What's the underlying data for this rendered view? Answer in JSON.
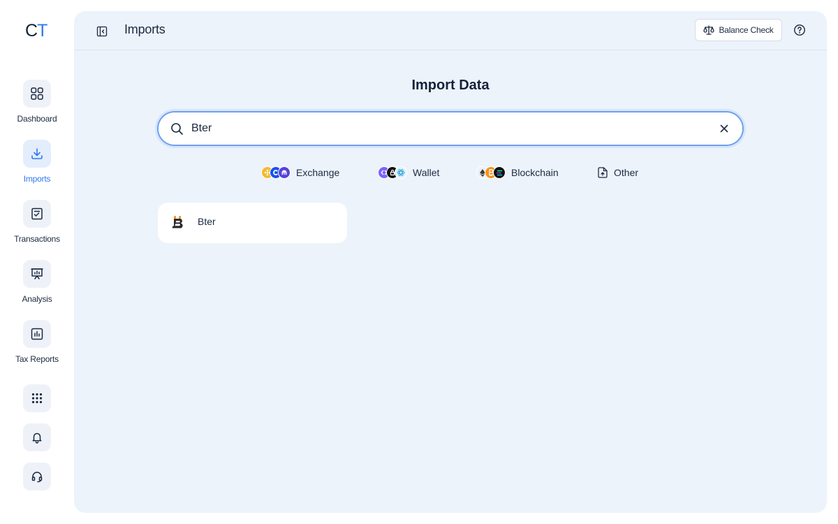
{
  "logo": {
    "c": "C",
    "t": "T"
  },
  "sidebar": {
    "items": [
      {
        "label": "Dashboard",
        "icon": "dashboard-icon"
      },
      {
        "label": "Imports",
        "icon": "download-icon",
        "active": true
      },
      {
        "label": "Transactions",
        "icon": "transactions-icon"
      },
      {
        "label": "Analysis",
        "icon": "presentation-chart-icon"
      },
      {
        "label": "Tax Reports",
        "icon": "bar-chart-icon"
      }
    ],
    "utility": [
      {
        "icon": "apps-grid-icon"
      },
      {
        "icon": "bell-icon"
      },
      {
        "icon": "headset-icon"
      }
    ]
  },
  "header": {
    "title": "Imports",
    "balance_check": "Balance Check"
  },
  "main": {
    "heading": "Import Data",
    "search": {
      "value": "Bter"
    },
    "filters": [
      {
        "label": "Exchange",
        "icons": [
          "binance-icon",
          "coinbase-icon",
          "kraken-icon"
        ]
      },
      {
        "label": "Wallet",
        "icons": [
          "exodus-icon",
          "ledger-icon",
          "atomic-icon"
        ]
      },
      {
        "label": "Blockchain",
        "icons": [
          "ethereum-icon",
          "bitcoin-icon",
          "solana-icon"
        ]
      },
      {
        "label": "Other",
        "icons": [
          "file-upload-icon"
        ]
      }
    ],
    "results": [
      {
        "name": "Bter",
        "icon": "bter-logo-icon"
      }
    ]
  },
  "colors": {
    "accent": "#2f78f4",
    "panel": "#edf3fb",
    "text": "#1b2a41",
    "binance": "#f3ba2f",
    "coinbase": "#1652f0",
    "kraken": "#5741d9",
    "bitcoin": "#f7931a"
  }
}
